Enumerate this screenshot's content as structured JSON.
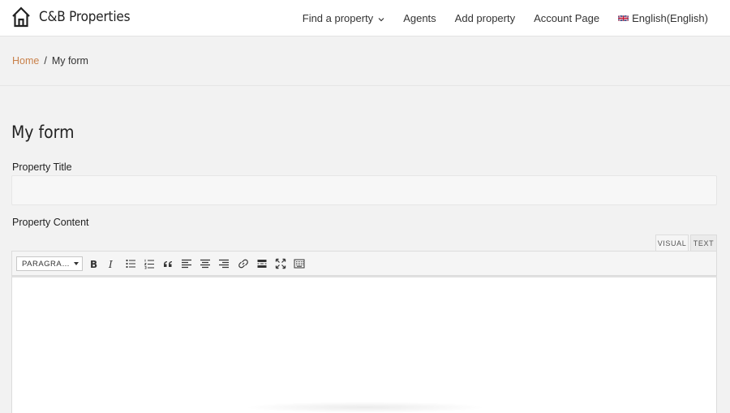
{
  "header": {
    "brand": "C&B Properties",
    "nav": [
      {
        "label": "Find a property",
        "has_dropdown": true
      },
      {
        "label": "Agents"
      },
      {
        "label": "Add property"
      },
      {
        "label": "Account Page"
      },
      {
        "label": "English(English)",
        "icon": "uk-flag-icon"
      }
    ]
  },
  "breadcrumb": {
    "home": "Home",
    "separator": "/",
    "current": "My form"
  },
  "form": {
    "title": "My form",
    "property_title_label": "Property Title",
    "property_title_value": "",
    "property_content_label": "Property Content",
    "editor": {
      "tabs": [
        "VISUAL",
        "TEXT"
      ],
      "active_tab": "VISUAL",
      "format_select": "PARAGRA…",
      "toolbar_icons": [
        "bold-icon",
        "italic-icon",
        "bulleted-list-icon",
        "numbered-list-icon",
        "blockquote-icon",
        "align-left-icon",
        "align-center-icon",
        "align-right-icon",
        "link-icon",
        "read-more-icon",
        "fullscreen-icon",
        "toolbar-toggle-icon"
      ]
    }
  },
  "colors": {
    "accent_link": "#c9814a",
    "page_bg": "#f2f2f2",
    "header_bg": "#ffffff"
  }
}
